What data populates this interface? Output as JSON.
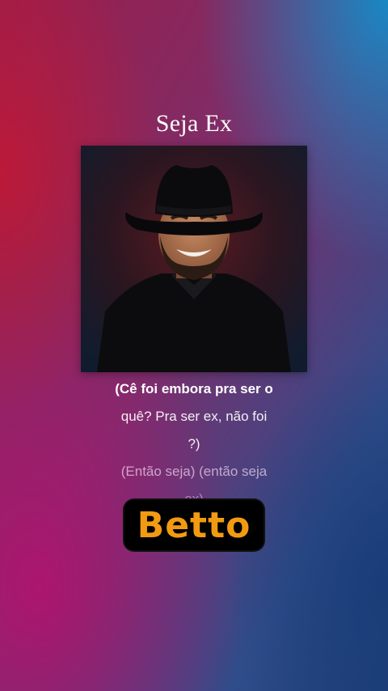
{
  "song": {
    "title": "Seja Ex",
    "cover_alt": "album-art-portrait"
  },
  "lyrics": {
    "lines": [
      "(Cê foi embora pra ser o",
      "quê? Pra ser ex, não foi",
      "?)",
      "(Então seja) (então seja",
      "ex)"
    ]
  },
  "artist": {
    "logo_text": "Betto"
  },
  "colors": {
    "logo_fill": "#f29a12",
    "logo_background": "#000000",
    "text": "#ffffff"
  }
}
